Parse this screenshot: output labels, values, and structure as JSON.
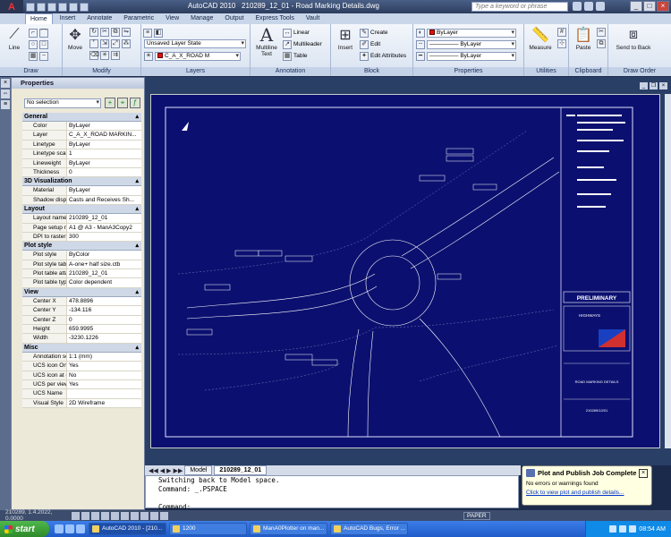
{
  "titlebar": {
    "app_name": "AutoCAD 2010",
    "doc_name": "210289_12_01 - Road Marking Details.dwg",
    "search_placeholder": "Type a keyword or phrase"
  },
  "ribbon_tabs": [
    "Home",
    "Insert",
    "Annotate",
    "Parametric",
    "View",
    "Manage",
    "Output",
    "Express Tools",
    "Vault"
  ],
  "ribbon": {
    "draw": {
      "label": "Draw",
      "line": "Line"
    },
    "modify": {
      "label": "Modify",
      "move": "Move"
    },
    "layers": {
      "label": "Layers",
      "layer_state": "Unsaved Layer State",
      "current_layer": "C_A_X_ROAD M"
    },
    "annotation": {
      "label": "Annotation",
      "multiline_text": "Multiline Text",
      "linear": "Linear",
      "multileader": "Multileader",
      "table": "Table"
    },
    "block": {
      "label": "Block",
      "insert": "Insert",
      "create": "Create",
      "edit": "Edit",
      "edit_attributes": "Edit Attributes"
    },
    "properties": {
      "label": "Properties",
      "color": "ByLayer",
      "linetype": "ByLayer",
      "lineweight": "ByLayer"
    },
    "utilities": {
      "label": "Utilities",
      "measure": "Measure"
    },
    "clipboard": {
      "label": "Clipboard",
      "paste": "Paste"
    },
    "draw_order": {
      "label": "Draw Order",
      "send_to_back": "Send to Back"
    }
  },
  "properties_palette": {
    "title": "Properties",
    "selection": "No selection",
    "sections": [
      {
        "name": "General",
        "rows": [
          {
            "key": "Color",
            "value": "ByLayer"
          },
          {
            "key": "Layer",
            "value": "C_A_X_ROAD MARKIN..."
          },
          {
            "key": "Linetype",
            "value": "ByLayer"
          },
          {
            "key": "Linetype scale",
            "value": "1"
          },
          {
            "key": "Lineweight",
            "value": "ByLayer"
          },
          {
            "key": "Thickness",
            "value": "0"
          }
        ]
      },
      {
        "name": "3D Visualization",
        "rows": [
          {
            "key": "Material",
            "value": "ByLayer"
          },
          {
            "key": "Shadow display",
            "value": "Casts and Receives Sh..."
          }
        ]
      },
      {
        "name": "Layout",
        "rows": [
          {
            "key": "Layout name",
            "value": "210289_12_01"
          },
          {
            "key": "Page setup na...",
            "value": "A1 @ A3 - ManA3Copy2"
          },
          {
            "key": "DPI to raster",
            "value": "300"
          }
        ]
      },
      {
        "name": "Plot style",
        "rows": [
          {
            "key": "Plot style",
            "value": "ByColor"
          },
          {
            "key": "Plot style table",
            "value": "A-one+ half size.ctb"
          },
          {
            "key": "Plot table atta...",
            "value": "210289_12_01"
          },
          {
            "key": "Plot table type",
            "value": "Color dependent"
          }
        ]
      },
      {
        "name": "View",
        "rows": [
          {
            "key": "Center X",
            "value": "478.8896"
          },
          {
            "key": "Center Y",
            "value": "-134.116"
          },
          {
            "key": "Center Z",
            "value": "0"
          },
          {
            "key": "Height",
            "value": "659.9995"
          },
          {
            "key": "Width",
            "value": "-3230.1226"
          }
        ]
      },
      {
        "name": "Misc",
        "rows": [
          {
            "key": "Annotation scale",
            "value": "1:1 (mm)"
          },
          {
            "key": "UCS icon On",
            "value": "Yes"
          },
          {
            "key": "UCS icon at or...",
            "value": "No"
          },
          {
            "key": "UCS per view...",
            "value": "Yes"
          },
          {
            "key": "UCS Name",
            "value": ""
          },
          {
            "key": "Visual Style",
            "value": "2D Wireframe"
          }
        ]
      }
    ]
  },
  "drawing": {
    "preliminary": "PRELIMINARY",
    "company": "HIGHWAYS",
    "road_marking": "ROAD MARKING DETAILS",
    "drawing_no": "210289/12/01"
  },
  "layout_tabs": [
    "Model",
    "210289_12_01"
  ],
  "command_lines": [
    "Switching back to Model space.",
    "Command: _.PSPACE",
    "",
    "Command:"
  ],
  "balloon": {
    "title": "Plot and Publish Job Complete",
    "message": "No errors or warnings found",
    "link": "Click to view plot and publish details..."
  },
  "statusbar": {
    "coords": "210289, 1.4.2022, 0.0000",
    "paper": "PAPER"
  },
  "taskbar": {
    "start": "start",
    "tasks": [
      "AutoCAD 2010 - [210...",
      "1200",
      "ManA0Plotter on man...",
      "AutoCAD Bugs, Error ..."
    ],
    "clock": "08:54 AM"
  }
}
